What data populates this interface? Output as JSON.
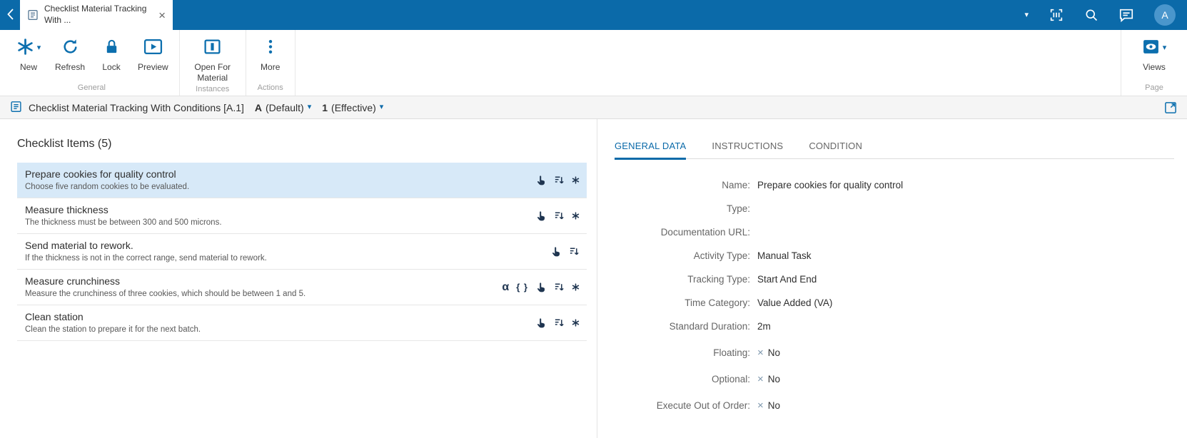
{
  "colors": {
    "brand": "#0b6aa9",
    "selected_row": "#d7e9f8",
    "x_mark": "#7d97ad",
    "dark_icon": "#1f3550"
  },
  "glyphs": {
    "caret_down": "▾",
    "close": "×",
    "x_mark": "×",
    "alpha": "α",
    "braces": "{ }"
  },
  "topbar": {
    "tab": {
      "title": "Checklist Material Tracking With ...",
      "icon": "checklist-document-icon"
    },
    "avatar": "A",
    "icons": [
      "back-chevron-icon",
      "dropdown-caret-icon",
      "scan-barcode-icon",
      "search-icon",
      "chat-icon",
      "avatar"
    ]
  },
  "ribbon": {
    "buttons": {
      "new": "New",
      "refresh": "Refresh",
      "lock": "Lock",
      "preview": "Preview",
      "open_for_material": "Open For Material",
      "more": "More",
      "views": "Views"
    },
    "groups": {
      "general": "General",
      "instances": "Instances",
      "actions": "Actions",
      "page": "Page"
    }
  },
  "breadcrumb": {
    "title": "Checklist Material Tracking With Conditions [A.1]",
    "version": "A",
    "version_suffix": "(Default)",
    "revision": "1",
    "revision_suffix": "(Effective)"
  },
  "checklist": {
    "heading": "Checklist Items (5)",
    "items": [
      {
        "title": "Prepare cookies for quality control",
        "subtitle": "Choose five random cookies to be evaluated.",
        "selected": true,
        "icons": [
          "manual-task-hand",
          "sequence-order",
          "required-asterisk"
        ]
      },
      {
        "title": "Measure thickness",
        "subtitle": "The thickness must be between 300 and 500 microns.",
        "selected": false,
        "icons": [
          "manual-task-hand",
          "sequence-order",
          "required-asterisk"
        ]
      },
      {
        "title": "Send material to rework.",
        "subtitle": "If the thickness is not in the correct range, send material to rework.",
        "selected": false,
        "icons": [
          "manual-task-hand",
          "sequence-order"
        ]
      },
      {
        "title": "Measure crunchiness",
        "subtitle": "Measure the crunchiness of three cookies, which should be between 1 and 5.",
        "selected": false,
        "icons": [
          "data-collection-alpha",
          "parameters-braces",
          "manual-task-hand",
          "sequence-order",
          "required-asterisk"
        ]
      },
      {
        "title": "Clean station",
        "subtitle": "Clean the station to prepare it for the next batch.",
        "selected": false,
        "icons": [
          "manual-task-hand",
          "sequence-order",
          "required-asterisk"
        ]
      }
    ]
  },
  "details": {
    "tabs": [
      {
        "label": "GENERAL DATA",
        "active": true
      },
      {
        "label": "INSTRUCTIONS",
        "active": false
      },
      {
        "label": "CONDITION",
        "active": false
      }
    ],
    "fields": [
      {
        "label": "Name:",
        "value": "Prepare cookies for quality control"
      },
      {
        "label": "Type:",
        "value": ""
      },
      {
        "label": "Documentation URL:",
        "value": ""
      },
      {
        "label": "Activity Type:",
        "value": "Manual Task"
      },
      {
        "label": "Tracking Type:",
        "value": "Start And End"
      },
      {
        "label": "Time Category:",
        "value": "Value Added (VA)"
      },
      {
        "label": "Standard Duration:",
        "value": "2m"
      },
      {
        "label": "Floating:",
        "value": "No",
        "x_mark": "×"
      },
      {
        "label": "Optional:",
        "value": "No",
        "x_mark": "×"
      },
      {
        "label": "Execute Out of Order:",
        "value": "No",
        "x_mark": "×"
      }
    ]
  }
}
